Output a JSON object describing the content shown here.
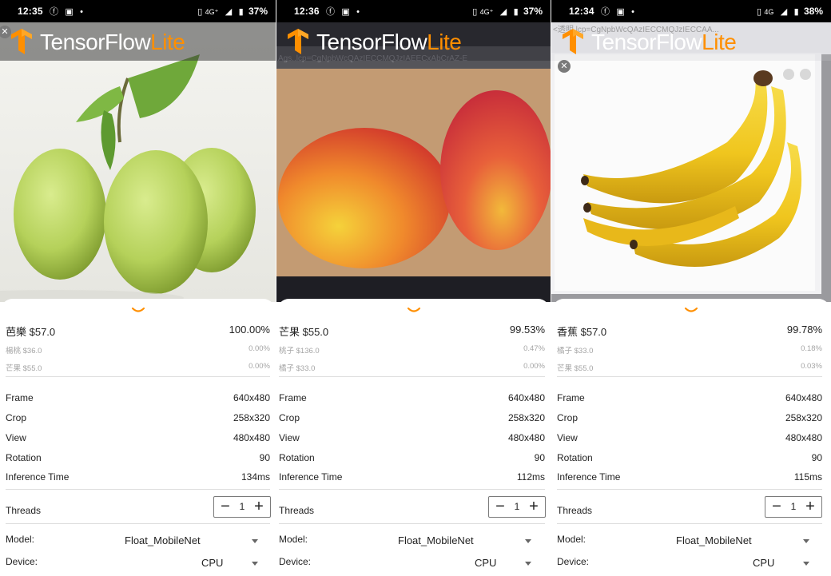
{
  "screens": [
    {
      "status": {
        "time": "12:35",
        "network": "4G⁺",
        "battery": "37%"
      },
      "brand": {
        "word1": "TensorFlow",
        "word2": "Lite"
      },
      "results": [
        {
          "label": "芭樂 $57.0",
          "confidence": "100.00%"
        },
        {
          "label": "楊桃 $36.0",
          "confidence": "0.00%"
        },
        {
          "label": "芒果 $55.0",
          "confidence": "0.00%"
        }
      ],
      "info": [
        {
          "label": "Frame",
          "value": "640x480"
        },
        {
          "label": "Crop",
          "value": "258x320"
        },
        {
          "label": "View",
          "value": "480x480"
        },
        {
          "label": "Rotation",
          "value": "90"
        },
        {
          "label": "Inference Time",
          "value": "134ms"
        }
      ],
      "threads": {
        "label": "Threads",
        "value": "1"
      },
      "model": {
        "label": "Model:",
        "value": "Float_MobileNet"
      },
      "device": {
        "label": "Device:",
        "value": "CPU"
      }
    },
    {
      "status": {
        "time": "12:36",
        "network": "4G⁺",
        "battery": "37%"
      },
      "brand": {
        "word1": "TensorFlow",
        "word2": "Lite"
      },
      "results": [
        {
          "label": "芒果 $55.0",
          "confidence": "99.53%"
        },
        {
          "label": "桃子 $136.0",
          "confidence": "0.47%"
        },
        {
          "label": "橘子 $33.0",
          "confidence": "0.00%"
        }
      ],
      "info": [
        {
          "label": "Frame",
          "value": "640x480"
        },
        {
          "label": "Crop",
          "value": "258x320"
        },
        {
          "label": "View",
          "value": "480x480"
        },
        {
          "label": "Rotation",
          "value": "90"
        },
        {
          "label": "Inference Time",
          "value": "112ms"
        }
      ],
      "threads": {
        "label": "Threads",
        "value": "1"
      },
      "model": {
        "label": "Model:",
        "value": "Float_MobileNet"
      },
      "device": {
        "label": "Device:",
        "value": "CPU"
      }
    },
    {
      "status": {
        "time": "12:34",
        "network": "4G",
        "battery": "38%"
      },
      "brand": {
        "word1": "TensorFlow",
        "word2": "Lite"
      },
      "results": [
        {
          "label": "香蕉 $57.0",
          "confidence": "99.78%"
        },
        {
          "label": "橘子 $33.0",
          "confidence": "0.18%"
        },
        {
          "label": "芒果 $55.0",
          "confidence": "0.03%"
        }
      ],
      "info": [
        {
          "label": "Frame",
          "value": "640x480"
        },
        {
          "label": "Crop",
          "value": "258x320"
        },
        {
          "label": "View",
          "value": "480x480"
        },
        {
          "label": "Rotation",
          "value": "90"
        },
        {
          "label": "Inference Time",
          "value": "115ms"
        }
      ],
      "threads": {
        "label": "Threads",
        "value": "1"
      },
      "model": {
        "label": "Model:",
        "value": "Float_MobileNet"
      },
      "device": {
        "label": "Device:",
        "value": "CPU"
      }
    }
  ],
  "colors": {
    "accent": "#ff8f00",
    "statusbar": "#000000"
  },
  "icons": [
    "facebook-icon",
    "youtube-icon",
    "vibrate-icon",
    "signal-icon",
    "battery-icon",
    "tensorflow-logo-icon",
    "chevron-down-icon",
    "close-icon",
    "minus-icon",
    "plus-icon",
    "dropdown-caret-icon"
  ]
}
